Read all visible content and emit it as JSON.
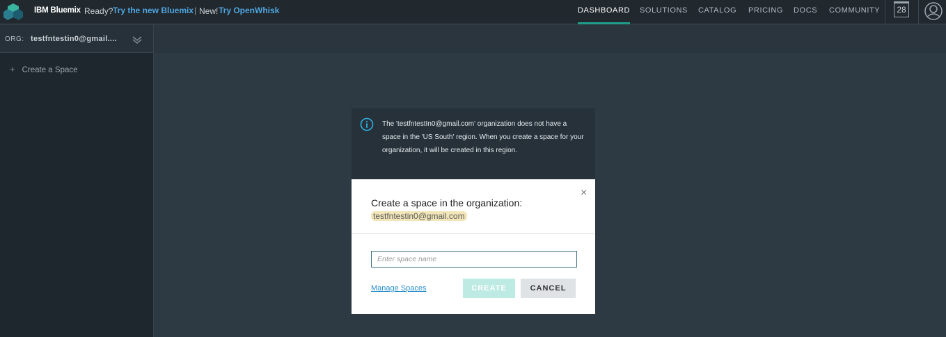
{
  "header": {
    "brand": "IBM Bluemix",
    "ready_text": "Ready?",
    "try_new_link": "Try the new Bluemix",
    "separator": "|",
    "new_text": "New!",
    "try_openwhisk_link": "Try OpenWhisk",
    "nav": [
      {
        "label": "DASHBOARD",
        "active": true
      },
      {
        "label": "SOLUTIONS",
        "active": false
      },
      {
        "label": "CATALOG",
        "active": false
      },
      {
        "label": "PRICING",
        "active": false
      },
      {
        "label": "DOCS",
        "active": false
      },
      {
        "label": "COMMUNITY",
        "active": false
      }
    ],
    "calendar_day": "28"
  },
  "sidebar": {
    "org_label": "ORG:",
    "org_value": "testfntestin0@gmail....",
    "create_space": "Create a Space"
  },
  "info_panel": {
    "message": "The 'testfntestIn0@gmail.com' organization does not have a space in the 'US South' region. When you create a space for your organization, it will be created in this region."
  },
  "dialog": {
    "title": "Create a space in the organization:",
    "org_name": "testfntestin0@gmail.com",
    "input_placeholder": "Enter space name",
    "manage_link": "Manage Spaces",
    "create_label": "CREATE",
    "cancel_label": "CANCEL",
    "close_symbol": "×"
  },
  "colors": {
    "accent": "#1f9c8a",
    "link": "#4fa6e0",
    "create_disabled": "#bdeae2"
  }
}
